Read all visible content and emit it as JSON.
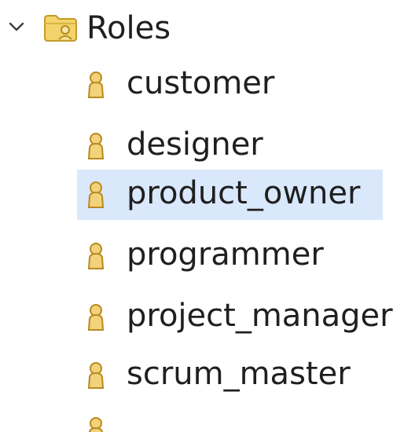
{
  "tree": {
    "root": {
      "label": "Roles",
      "expanded": true,
      "icon": "folder-roles-icon",
      "twisty_icon": "chevron-down-icon"
    },
    "children": [
      {
        "label": "customer",
        "icon": "role-icon",
        "selected": false
      },
      {
        "label": "designer",
        "icon": "role-icon",
        "selected": false
      },
      {
        "label": "product_owner",
        "icon": "role-icon",
        "selected": true
      },
      {
        "label": "programmer",
        "icon": "role-icon",
        "selected": false
      },
      {
        "label": "project_manager",
        "icon": "role-icon",
        "selected": false
      },
      {
        "label": "scrum_master",
        "icon": "role-icon",
        "selected": false
      }
    ]
  },
  "colors": {
    "selection_bg": "#d9e8fb",
    "text": "#1f1f1f",
    "role_icon_fill": "#f2d27a",
    "role_icon_stroke": "#b88a1f",
    "folder_fill": "#f3d46a"
  }
}
